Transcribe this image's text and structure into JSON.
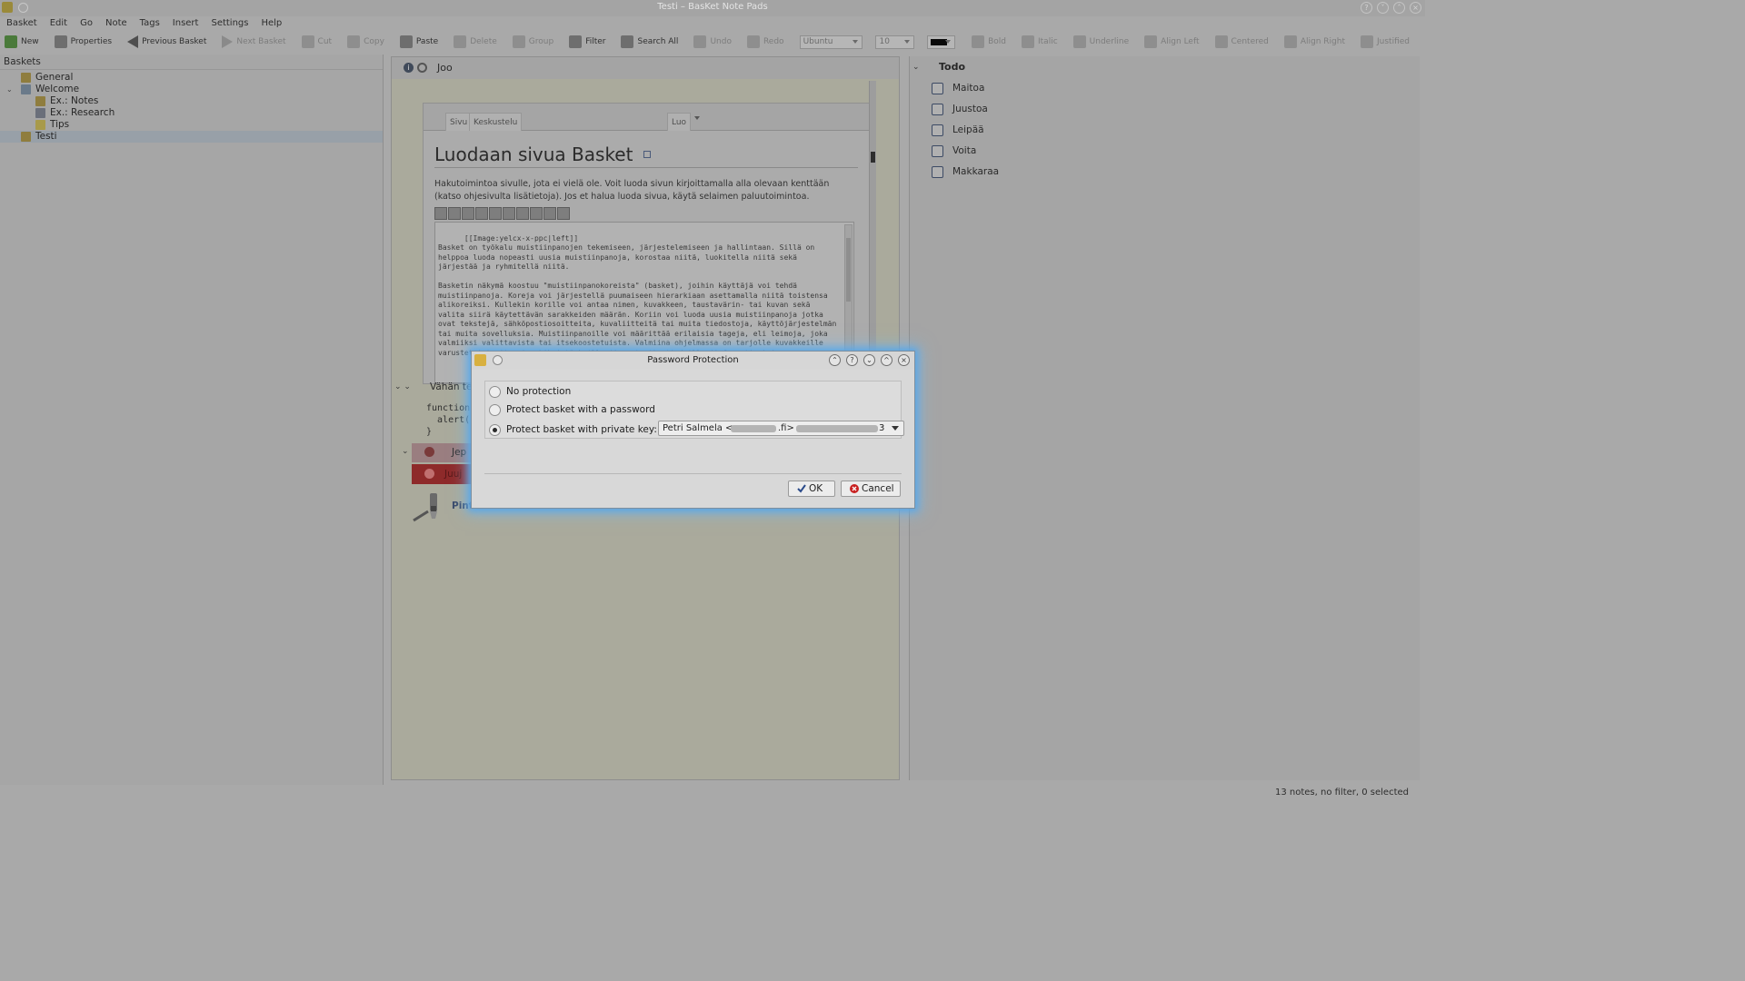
{
  "window": {
    "title": "Testi – BasKet Note Pads"
  },
  "menu": [
    "Basket",
    "Edit",
    "Go",
    "Note",
    "Tags",
    "Insert",
    "Settings",
    "Help"
  ],
  "toolbar": {
    "new": "New",
    "properties": "Properties",
    "previous_basket": "Previous Basket",
    "next_basket": "Next Basket",
    "cut": "Cut",
    "copy": "Copy",
    "paste": "Paste",
    "delete": "Delete",
    "group": "Group",
    "filter": "Filter",
    "search_all": "Search All",
    "undo": "Undo",
    "redo": "Redo",
    "font": "Ubuntu",
    "size": "10",
    "text_color": "#0a0a0a",
    "bold": "Bold",
    "italic": "Italic",
    "underline": "Underline",
    "align_left": "Align Left",
    "centered": "Centered",
    "align_right": "Align Right",
    "justified": "Justified"
  },
  "baskets_panel": {
    "header": "Baskets",
    "items": [
      {
        "label": "General",
        "level": 0,
        "selected": false
      },
      {
        "label": "Welcome",
        "level": 0,
        "selected": false,
        "expanded": true
      },
      {
        "label": "Ex.: Notes",
        "level": 1,
        "selected": false
      },
      {
        "label": "Ex.: Research",
        "level": 1,
        "selected": false
      },
      {
        "label": "Tips",
        "level": 1,
        "selected": false
      },
      {
        "label": "Testi",
        "level": 0,
        "selected": true
      }
    ]
  },
  "center": {
    "header": "Joo",
    "page_tabs": [
      "Sivu",
      "Keskustelu",
      "Luo"
    ],
    "page_heading": "Luodaan sivua Basket",
    "page_intro": "Hakutoimintoa sivulle, jota ei vielä ole. Voit luoda sivun kirjoittamalla alla olevaan kenttään (katso ohjesivulta lisätietoja). Jos et halua luoda sivua, käytä selaimen paluutoimintoa.",
    "page_intro_link": "ohjesivulta",
    "edit_text": "[[Image:yelcx-x-ppc|left]]\nBasket on työkalu muistiinpanojen tekemiseen, järjestelemiseen ja hallintaan. Sillä on helppoa luoda nopeasti uusia muistiinpanoja, korostaa niitä, luokitella niitä sekä järjestää ja ryhmitellä niitä.\n\nBasketin näkymä koostuu \"muistiinpanokoreista\" (basket), joihin käyttäjä voi tehdä muistiinpanoja. Koreja voi järjestellä puumaiseen hierarkiaan asettamalla niitä toistensa alikoreiksi. Kullekin korille voi antaa nimen, kuvakkeen, taustavärin- tai kuvan sekä valita siirä käytettävän sarakkeiden määrän. Koriin voi luoda uusia muistiinpanoja jotka ovat tekstejä, sähköpostiosoitteita, kuvaliitteitä tai muita tiedostoja, käyttöjärjestelmän tai muita sovelluksia. Muistiinpanoille voi määrittää erilaisia tageja, eli leimoja, joka valmiiksi valittavista tai itsekoostetuista. Valmiina ohjelmassa on tarjolle kuvakkeille varustetut tagit esimerkiksi tärkeille (important), tiedoille (information) ja ...",
    "group_label": "Vähän te",
    "code_line1": "function",
    "code_line2": "  alert('",
    "code_line3": "}",
    "jep": "Jep",
    "juuj": "Juuj",
    "pint": "Pint"
  },
  "todo": {
    "header": "Todo",
    "items": [
      {
        "label": "Maitoa",
        "checked": false
      },
      {
        "label": "Juustoa",
        "checked": false
      },
      {
        "label": "Leipää",
        "checked": false
      },
      {
        "label": "Voita",
        "checked": false
      },
      {
        "label": "Makkaraa",
        "checked": false
      }
    ]
  },
  "status": {
    "text": "13 notes, no filter, 0 selected"
  },
  "dialog": {
    "title": "Password Protection",
    "option_none": "No protection",
    "option_password": "Protect basket with a password",
    "option_key": "Protect basket with private key:",
    "selected_option": "key",
    "key_value_prefix": "Petri Salmela <",
    "key_value_mid": ".fi>",
    "key_value_suffix": "3",
    "ok_label": "OK",
    "cancel_label": "Cancel",
    "glow_color": "#5aa6e6"
  }
}
